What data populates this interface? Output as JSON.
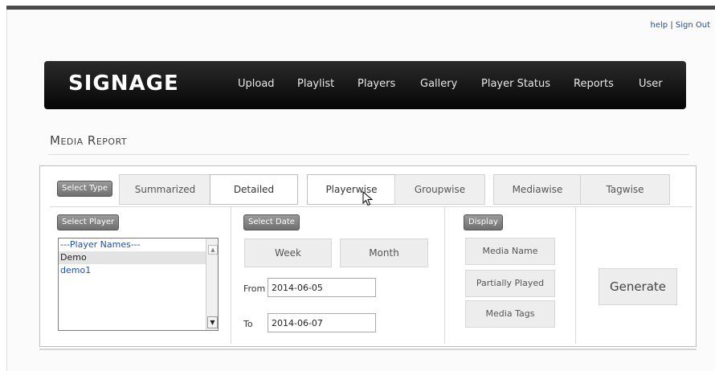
{
  "header": {
    "help_link": "help",
    "separator": "|",
    "signout_link": "Sign Out"
  },
  "navbar": {
    "logo": "SIGNAGE",
    "items": [
      "Upload",
      "Playlist",
      "Players",
      "Gallery",
      "Player Status",
      "Reports",
      "User"
    ]
  },
  "page": {
    "title_first": "Media",
    "title_second": "Report"
  },
  "type_section": {
    "label": "Select Type",
    "tabs": [
      "Summarized",
      "Detailed",
      "Playerwise",
      "Groupwise",
      "Mediawise",
      "Tagwise"
    ]
  },
  "player_section": {
    "label": "Select Player",
    "options": [
      "---Player Names---",
      "Demo",
      "demo1"
    ]
  },
  "date_section": {
    "label": "Select Date",
    "week_button": "Week",
    "month_button": "Month",
    "from_label": "From",
    "from_value": "2014-06-05",
    "to_label": "To",
    "to_value": "2014-06-07"
  },
  "display_section": {
    "label": "Display",
    "buttons": [
      "Media Name",
      "Partially Played",
      "Media Tags"
    ]
  },
  "generate_button": "Generate",
  "icons": {
    "cursor": "mouse-pointer-icon",
    "scroll_down": "chevron-down-icon",
    "scroll_up": "chevron-up-icon"
  }
}
